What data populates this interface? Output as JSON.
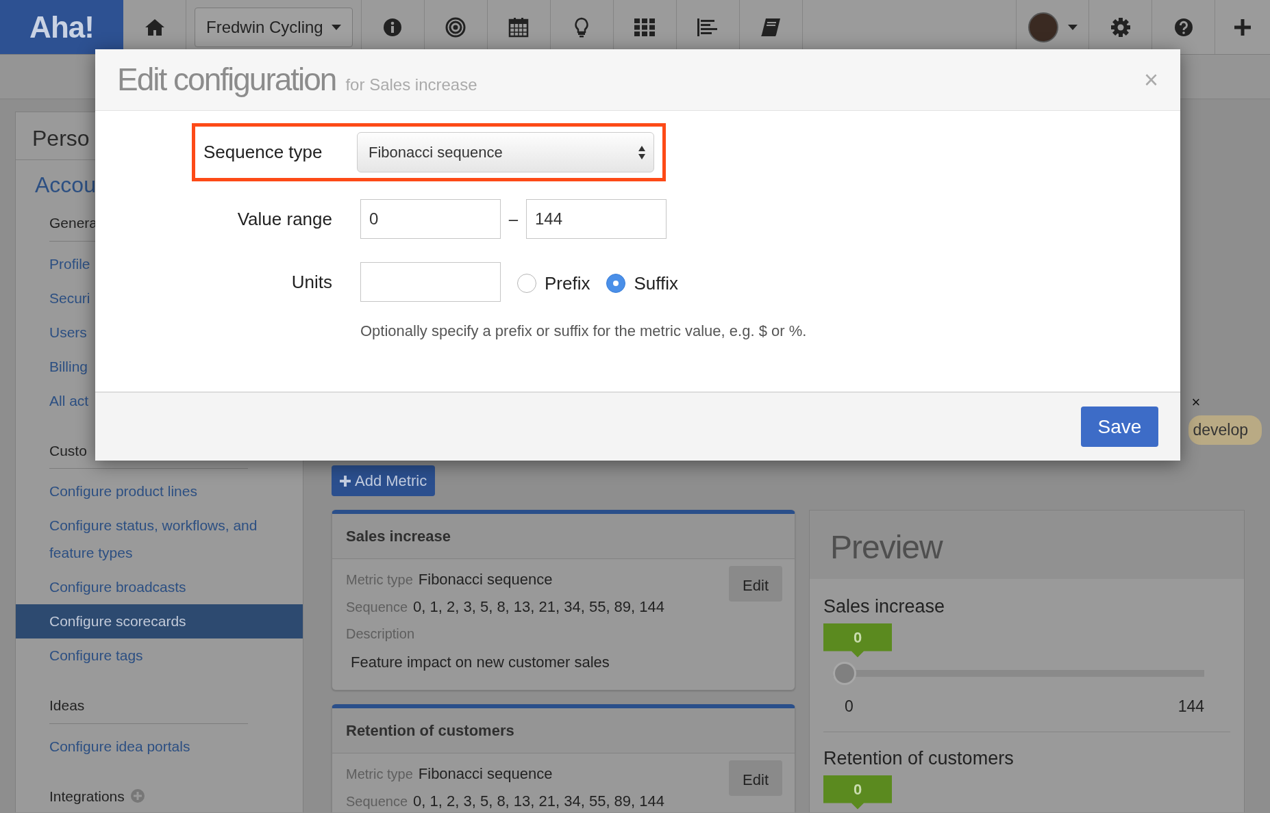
{
  "navbar": {
    "logo": "Aha!",
    "workspace_dropdown": "Fredwin Cycling"
  },
  "sidebar": {
    "title": "Perso",
    "heading": "Accou",
    "sections": [
      {
        "label": "Genera",
        "kind": "plain",
        "items": [
          {
            "label": "Profile",
            "selected": false
          },
          {
            "label": "Securi",
            "selected": false
          },
          {
            "label": "Users",
            "selected": false
          },
          {
            "label": "Billing",
            "selected": false
          },
          {
            "label": "All act",
            "selected": false
          }
        ]
      },
      {
        "label": "Custo",
        "kind": "plain",
        "items": [
          {
            "label": "Configure product lines",
            "selected": false
          },
          {
            "label": "Configure status, workflows, and feature types",
            "selected": false
          },
          {
            "label": "Configure broadcasts",
            "selected": false
          },
          {
            "label": "Configure scorecards",
            "selected": true
          },
          {
            "label": "Configure tags",
            "selected": false
          }
        ]
      },
      {
        "label": "Ideas",
        "kind": "plain",
        "items": [
          {
            "label": "Configure idea portals",
            "selected": false
          }
        ]
      },
      {
        "label": "Integrations",
        "kind": "addable"
      }
    ]
  },
  "tag": {
    "close": "×",
    "label": "develop"
  },
  "add_metric_button": "Add Metric",
  "metrics": [
    {
      "title": "Sales increase",
      "fields": [
        {
          "label": "Metric type",
          "value": "Fibonacci sequence"
        },
        {
          "label": "Sequence",
          "value": "0, 1, 2, 3, 5, 8, 13, 21, 34, 55, 89, 144"
        }
      ],
      "description_label": "Description",
      "description": "Feature impact on new customer sales",
      "edit": "Edit"
    },
    {
      "title": "Retention of customers",
      "fields": [
        {
          "label": "Metric type",
          "value": "Fibonacci sequence"
        },
        {
          "label": "Sequence",
          "value": "0, 1, 2, 3, 5, 8, 13, 21, 34, 55, 89, 144"
        }
      ],
      "edit": "Edit"
    }
  ],
  "preview": {
    "title": "Preview",
    "items": [
      {
        "name": "Sales increase",
        "badge": "0",
        "slider": {
          "level": 0,
          "min": "0",
          "max": "144"
        }
      },
      {
        "name": "Retention of customers",
        "badge": "0"
      }
    ]
  },
  "modal": {
    "title": "Edit configuration",
    "subtitle": "for Sales increase",
    "close": "×",
    "sequence_type": {
      "label": "Sequence type",
      "value": "Fibonacci sequence",
      "highlighted": true
    },
    "value_range": {
      "label": "Value range",
      "min": "0",
      "separator": "–",
      "max": "144"
    },
    "units": {
      "label": "Units",
      "options": [
        {
          "label": "Prefix",
          "selected": false
        },
        {
          "label": "Suffix",
          "selected": true
        }
      ]
    },
    "help": "Optionally specify a prefix or suffix for the metric value, e.g. $ or %.",
    "save": "Save"
  }
}
